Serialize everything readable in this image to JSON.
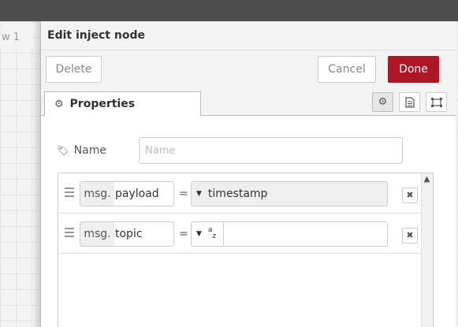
{
  "background": {
    "flow_tab_label": "w 1"
  },
  "tray": {
    "title": "Edit inject node",
    "buttons": {
      "delete": "Delete",
      "cancel": "Cancel",
      "done": "Done"
    },
    "tabs": {
      "properties": "Properties"
    },
    "tab_icons": [
      "gear-icon",
      "description-icon",
      "appearance-icon"
    ]
  },
  "form": {
    "name_label": "Name",
    "name_placeholder": "Name",
    "name_value": "",
    "props": [
      {
        "prefix": "msg.",
        "field": "payload",
        "equals": "=",
        "type_label": "timestamp",
        "type_icon": "caret-down-icon",
        "value": ""
      },
      {
        "prefix": "msg.",
        "field": "topic",
        "equals": "=",
        "type_label": "az",
        "type_icon": "caret-down-icon",
        "value": ""
      }
    ]
  },
  "colors": {
    "done": "#ad1625",
    "header": "#4d4d4d"
  }
}
